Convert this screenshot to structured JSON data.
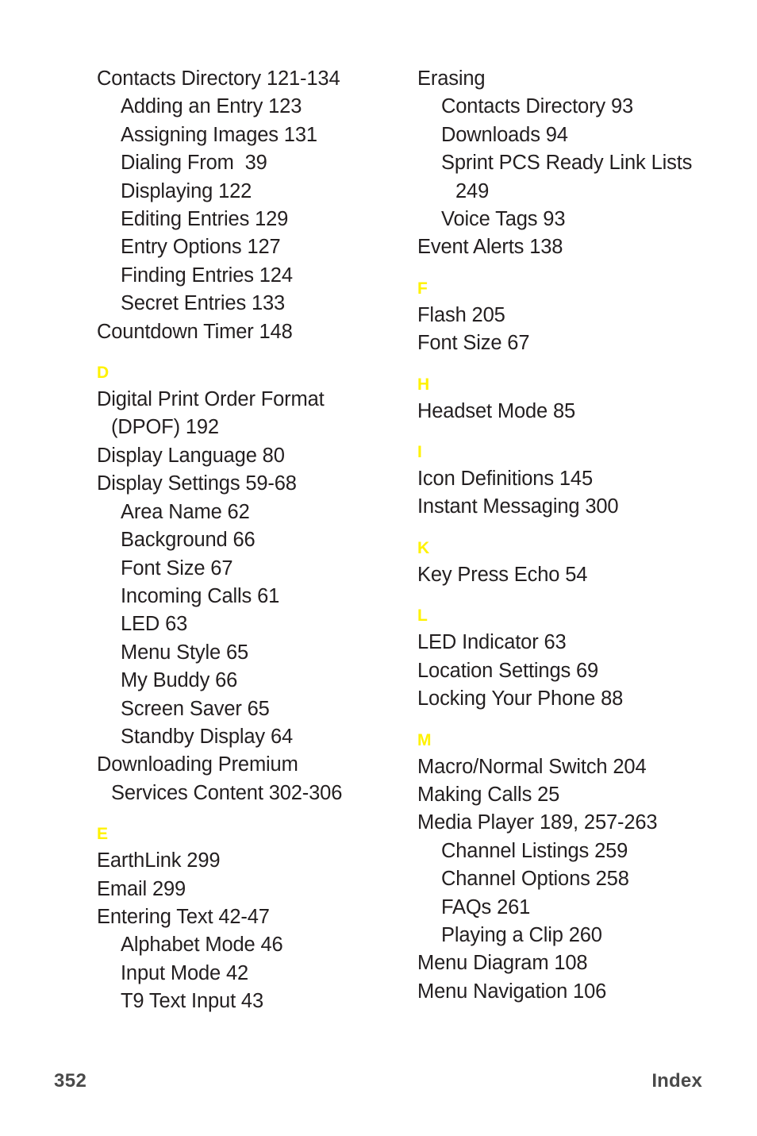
{
  "document": {
    "page_number": "352",
    "running_head": "Index",
    "accent_color": "#fff200",
    "text_color": "#231f20",
    "footer_color": "#4a4a4a",
    "background_color": "#ffffff"
  },
  "columns": {
    "left": [
      {
        "letter": "",
        "entries": [
          {
            "text": "Contacts Directory 121-134",
            "level": 0
          },
          {
            "text": "Adding an Entry 123",
            "level": 1
          },
          {
            "text": "Assigning Images 131",
            "level": 1
          },
          {
            "text": "Dialing From  39",
            "level": 1
          },
          {
            "text": "Displaying 122",
            "level": 1
          },
          {
            "text": "Editing Entries 129",
            "level": 1
          },
          {
            "text": "Entry Options 127",
            "level": 1
          },
          {
            "text": "Finding Entries 124",
            "level": 1
          },
          {
            "text": "Secret Entries 133",
            "level": 1
          },
          {
            "text": "Countdown Timer 148",
            "level": 0
          }
        ]
      },
      {
        "letter": "D",
        "entries": [
          {
            "text": "Digital Print Order Format",
            "level": 0
          },
          {
            "text": "(DPOF) 192",
            "level": "cont0"
          },
          {
            "text": "Display Language 80",
            "level": 0
          },
          {
            "text": "Display Settings 59-68",
            "level": 0
          },
          {
            "text": "Area Name 62",
            "level": 1
          },
          {
            "text": "Background 66",
            "level": 1
          },
          {
            "text": "Font Size 67",
            "level": 1
          },
          {
            "text": "Incoming Calls 61",
            "level": 1
          },
          {
            "text": "LED 63",
            "level": 1
          },
          {
            "text": "Menu Style 65",
            "level": 1
          },
          {
            "text": "My Buddy 66",
            "level": 1
          },
          {
            "text": "Screen Saver 65",
            "level": 1
          },
          {
            "text": "Standby Display 64",
            "level": 1
          },
          {
            "text": "Downloading Premium",
            "level": 0
          },
          {
            "text": "Services Content 302-306",
            "level": "cont0"
          }
        ]
      },
      {
        "letter": "E",
        "entries": [
          {
            "text": "EarthLink 299",
            "level": 0
          },
          {
            "text": "Email 299",
            "level": 0
          },
          {
            "text": "Entering Text 42-47",
            "level": 0
          },
          {
            "text": "Alphabet Mode 46",
            "level": 1
          },
          {
            "text": "Input Mode 42",
            "level": 1
          },
          {
            "text": "T9 Text Input 43",
            "level": 1
          }
        ]
      }
    ],
    "right": [
      {
        "letter": "",
        "entries": [
          {
            "text": "Erasing",
            "level": 0
          },
          {
            "text": "Contacts Directory 93",
            "level": 1
          },
          {
            "text": "Downloads 94",
            "level": 1
          },
          {
            "text": "Sprint PCS Ready Link Lists",
            "level": 1
          },
          {
            "text": "249",
            "level": "cont1"
          },
          {
            "text": "Voice Tags 93",
            "level": 1
          },
          {
            "text": "Event Alerts 138",
            "level": 0
          }
        ]
      },
      {
        "letter": "F",
        "entries": [
          {
            "text": "Flash 205",
            "level": 0
          },
          {
            "text": "Font Size 67",
            "level": 0
          }
        ]
      },
      {
        "letter": "H",
        "entries": [
          {
            "text": "Headset Mode 85",
            "level": 0
          }
        ]
      },
      {
        "letter": "I",
        "entries": [
          {
            "text": "Icon Definitions 145",
            "level": 0
          },
          {
            "text": "Instant Messaging 300",
            "level": 0
          }
        ]
      },
      {
        "letter": "K",
        "entries": [
          {
            "text": "Key Press Echo 54",
            "level": 0
          }
        ]
      },
      {
        "letter": "L",
        "entries": [
          {
            "text": "LED Indicator 63",
            "level": 0
          },
          {
            "text": "Location Settings 69",
            "level": 0
          },
          {
            "text": "Locking Your Phone 88",
            "level": 0
          }
        ]
      },
      {
        "letter": "M",
        "entries": [
          {
            "text": "Macro/Normal Switch 204",
            "level": 0
          },
          {
            "text": "Making Calls 25",
            "level": 0
          },
          {
            "text": "Media Player 189, 257-263",
            "level": 0
          },
          {
            "text": "Channel Listings 259",
            "level": 1
          },
          {
            "text": "Channel Options 258",
            "level": 1
          },
          {
            "text": "FAQs 261",
            "level": 1
          },
          {
            "text": "Playing a Clip 260",
            "level": 1
          },
          {
            "text": "Menu Diagram 108",
            "level": 0
          },
          {
            "text": "Menu Navigation 106",
            "level": 0
          }
        ]
      }
    ]
  }
}
